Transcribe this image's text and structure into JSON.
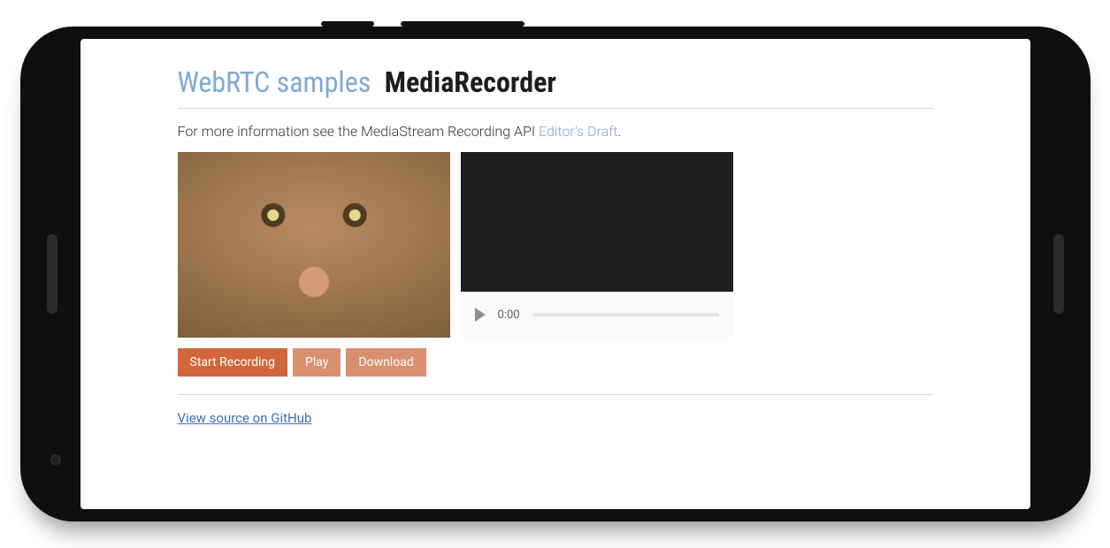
{
  "header": {
    "site_link": "WebRTC samples",
    "page_title": "MediaRecorder"
  },
  "info": {
    "prefix": "For more information see the MediaStream Recording API ",
    "link_text": "Editor's Draft",
    "suffix": "."
  },
  "player": {
    "current_time": "0:00"
  },
  "buttons": {
    "record": "Start Recording",
    "play": "Play",
    "download": "Download"
  },
  "footer": {
    "source_link": "View source on GitHub"
  }
}
